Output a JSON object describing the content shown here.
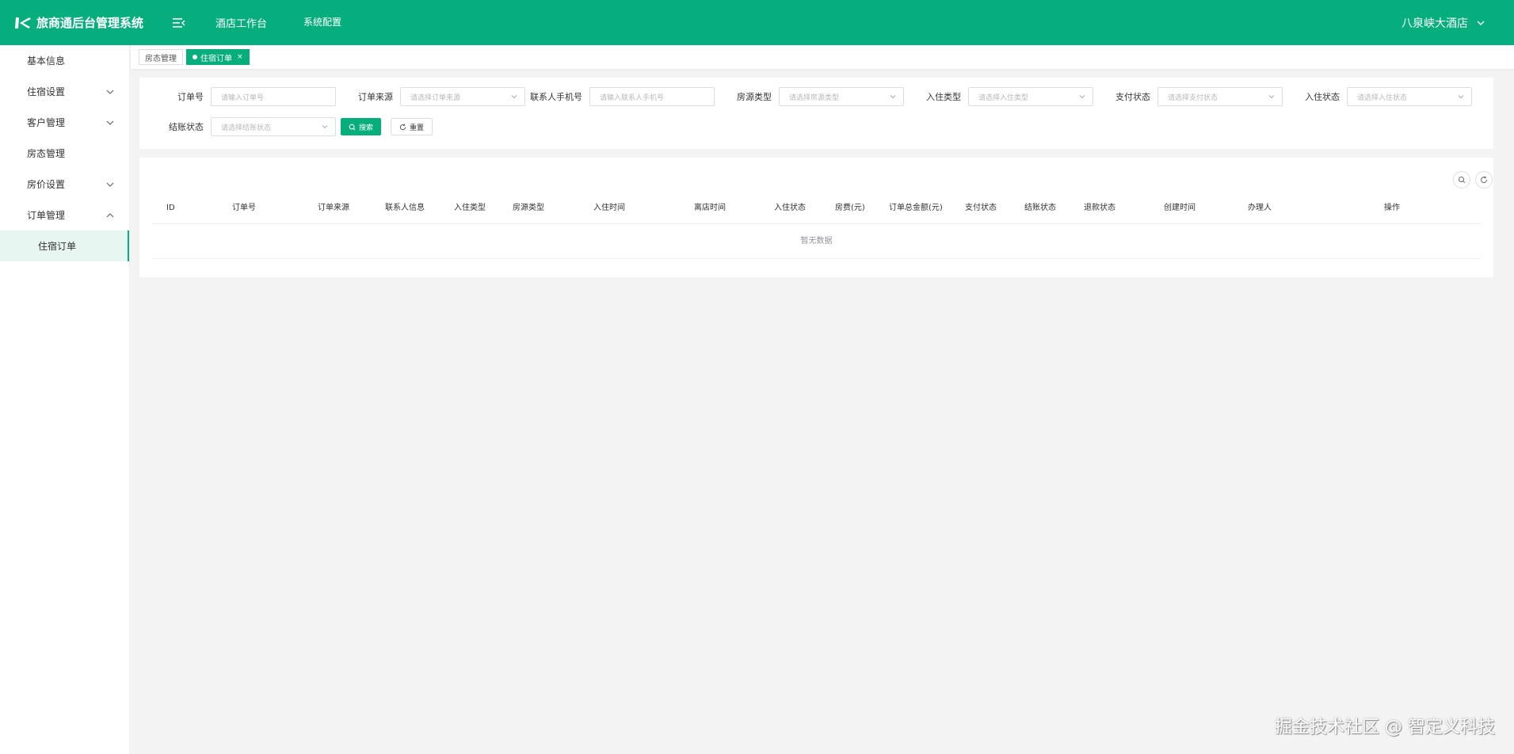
{
  "header": {
    "title": "旅商通后台管理系统",
    "nav": [
      "酒店工作台",
      "系统配置"
    ],
    "hotel_name": "八泉峡大酒店"
  },
  "sidebar": {
    "items": [
      {
        "label": "基本信息",
        "icon": "none"
      },
      {
        "label": "住宿设置",
        "icon": "chevron-down-icon"
      },
      {
        "label": "客户管理",
        "icon": "chevron-down-icon"
      },
      {
        "label": "房态管理",
        "icon": "none"
      },
      {
        "label": "房价设置",
        "icon": "chevron-down-icon"
      },
      {
        "label": "订单管理",
        "icon": "chevron-up-icon"
      },
      {
        "label": "住宿订单",
        "icon": "none",
        "active": true
      }
    ]
  },
  "tabs": [
    {
      "label": "房态管理"
    },
    {
      "label": "住宿订单",
      "active": true,
      "close": "×"
    }
  ],
  "search": {
    "fields": [
      {
        "label": "订单号",
        "placeholder": "请输入订单号"
      },
      {
        "label": "订单来源",
        "placeholder": "请选择订单来源"
      },
      {
        "label": "联系人手机号",
        "placeholder": "请输入联系人手机号"
      },
      {
        "label": "房源类型",
        "placeholder": "请选择房源类型"
      },
      {
        "label": "入住类型",
        "placeholder": "请选择入住类型"
      },
      {
        "label": "支付状态",
        "placeholder": "请选择支付状态"
      },
      {
        "label": "入住状态",
        "placeholder": "请选择入住状态"
      },
      {
        "label": "结账状态",
        "placeholder": "请选择结账状态"
      }
    ],
    "search_label": "搜索",
    "reset_label": "重置"
  },
  "table": {
    "columns": [
      "ID",
      "订单号",
      "订单来源",
      "联系人信息",
      "入住类型",
      "房源类型",
      "入住时间",
      "离店时间",
      "入住状态",
      "房费(元)",
      "订单总金额(元)",
      "支付状态",
      "结账状态",
      "退款状态",
      "创建时间",
      "办理人",
      "操作"
    ],
    "empty_text": "暂无数据"
  },
  "watermark": "掘金技术社区 @ 智定义科技",
  "colors": {
    "primary": "#06ae7e"
  }
}
